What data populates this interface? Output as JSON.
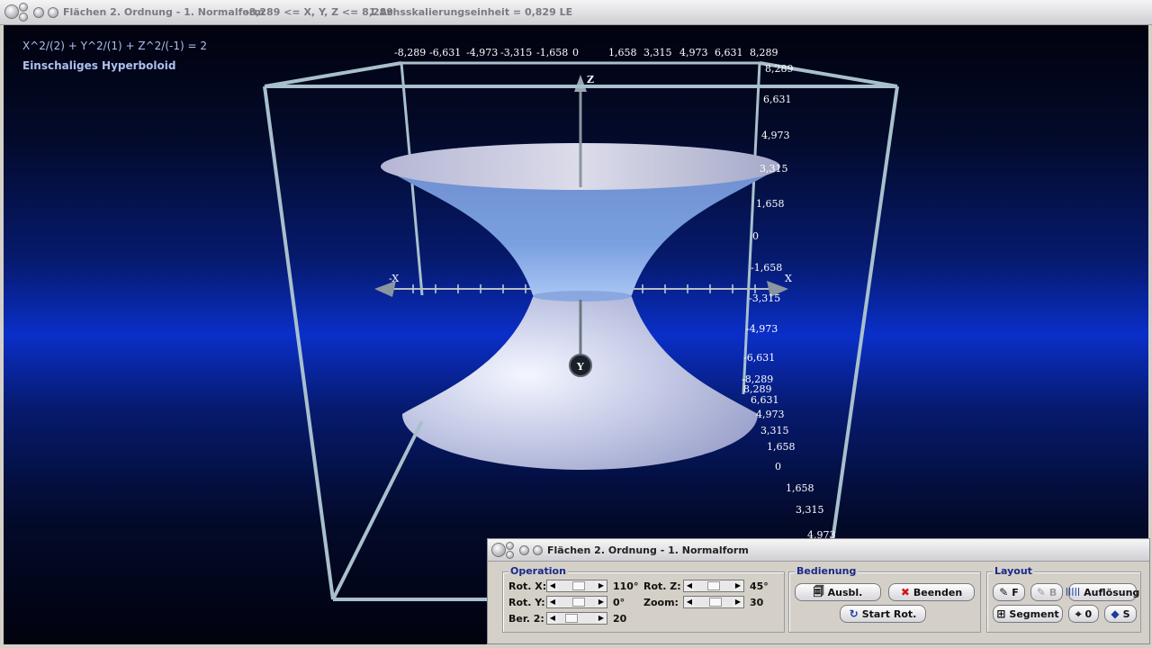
{
  "titlebar": {
    "title": "Flächen 2. Ordnung - 1. Normalform",
    "range": "-8,289 <= X, Y, Z <= 8,289",
    "scale": "1 Achsskalierungseinheit = 0,829 LE"
  },
  "viewport": {
    "equation": "X^2/(2) + Y^2/(1) + Z^2/(-1) = 2",
    "surface_name": "Einschaliges Hyperboloid",
    "top_ticks": [
      "-8,289",
      "-6,631",
      "-4,973",
      "-3,315",
      "-1,658",
      "0",
      "1,658",
      "3,315",
      "4,973",
      "6,631",
      "8,289"
    ],
    "z_ticks": [
      "8,289",
      "6,631",
      "4,973",
      "3,315",
      "1,658",
      "0",
      "-1,658",
      "-3,315",
      "-4,973",
      "-6,631",
      "-8,289"
    ],
    "y_ticks": [
      "8,289",
      "6,631",
      "4,973",
      "3,315",
      "1,658",
      "0",
      "1,658",
      "3,315",
      "4,973"
    ],
    "axis_labels": {
      "z": "Z",
      "x_neg": "-X",
      "x_pos": "X",
      "y": "Y"
    }
  },
  "panel": {
    "title": "Flächen 2. Ordnung  - 1. Normalform",
    "operation": {
      "label": "Operation",
      "rot_x_label": "Rot. X:",
      "rot_x_value": "110°",
      "rot_y_label": "Rot. Y:",
      "rot_y_value": "0°",
      "ber_z_label": "Ber. 2:",
      "ber_z_value": "20",
      "rot_z_label": "Rot. Z:",
      "rot_z_value": "45°",
      "zoom_label": "Zoom:",
      "zoom_value": "30"
    },
    "bedienung": {
      "label": "Bedienung",
      "ausbl": "Ausbl.",
      "beenden": "Beenden",
      "start_rot": "Start Rot."
    },
    "layout": {
      "label": "Layout",
      "f": "F",
      "b": "B",
      "aufloesung": "Auflösung",
      "segment": "Segment",
      "zero": "0",
      "s": "S"
    }
  }
}
